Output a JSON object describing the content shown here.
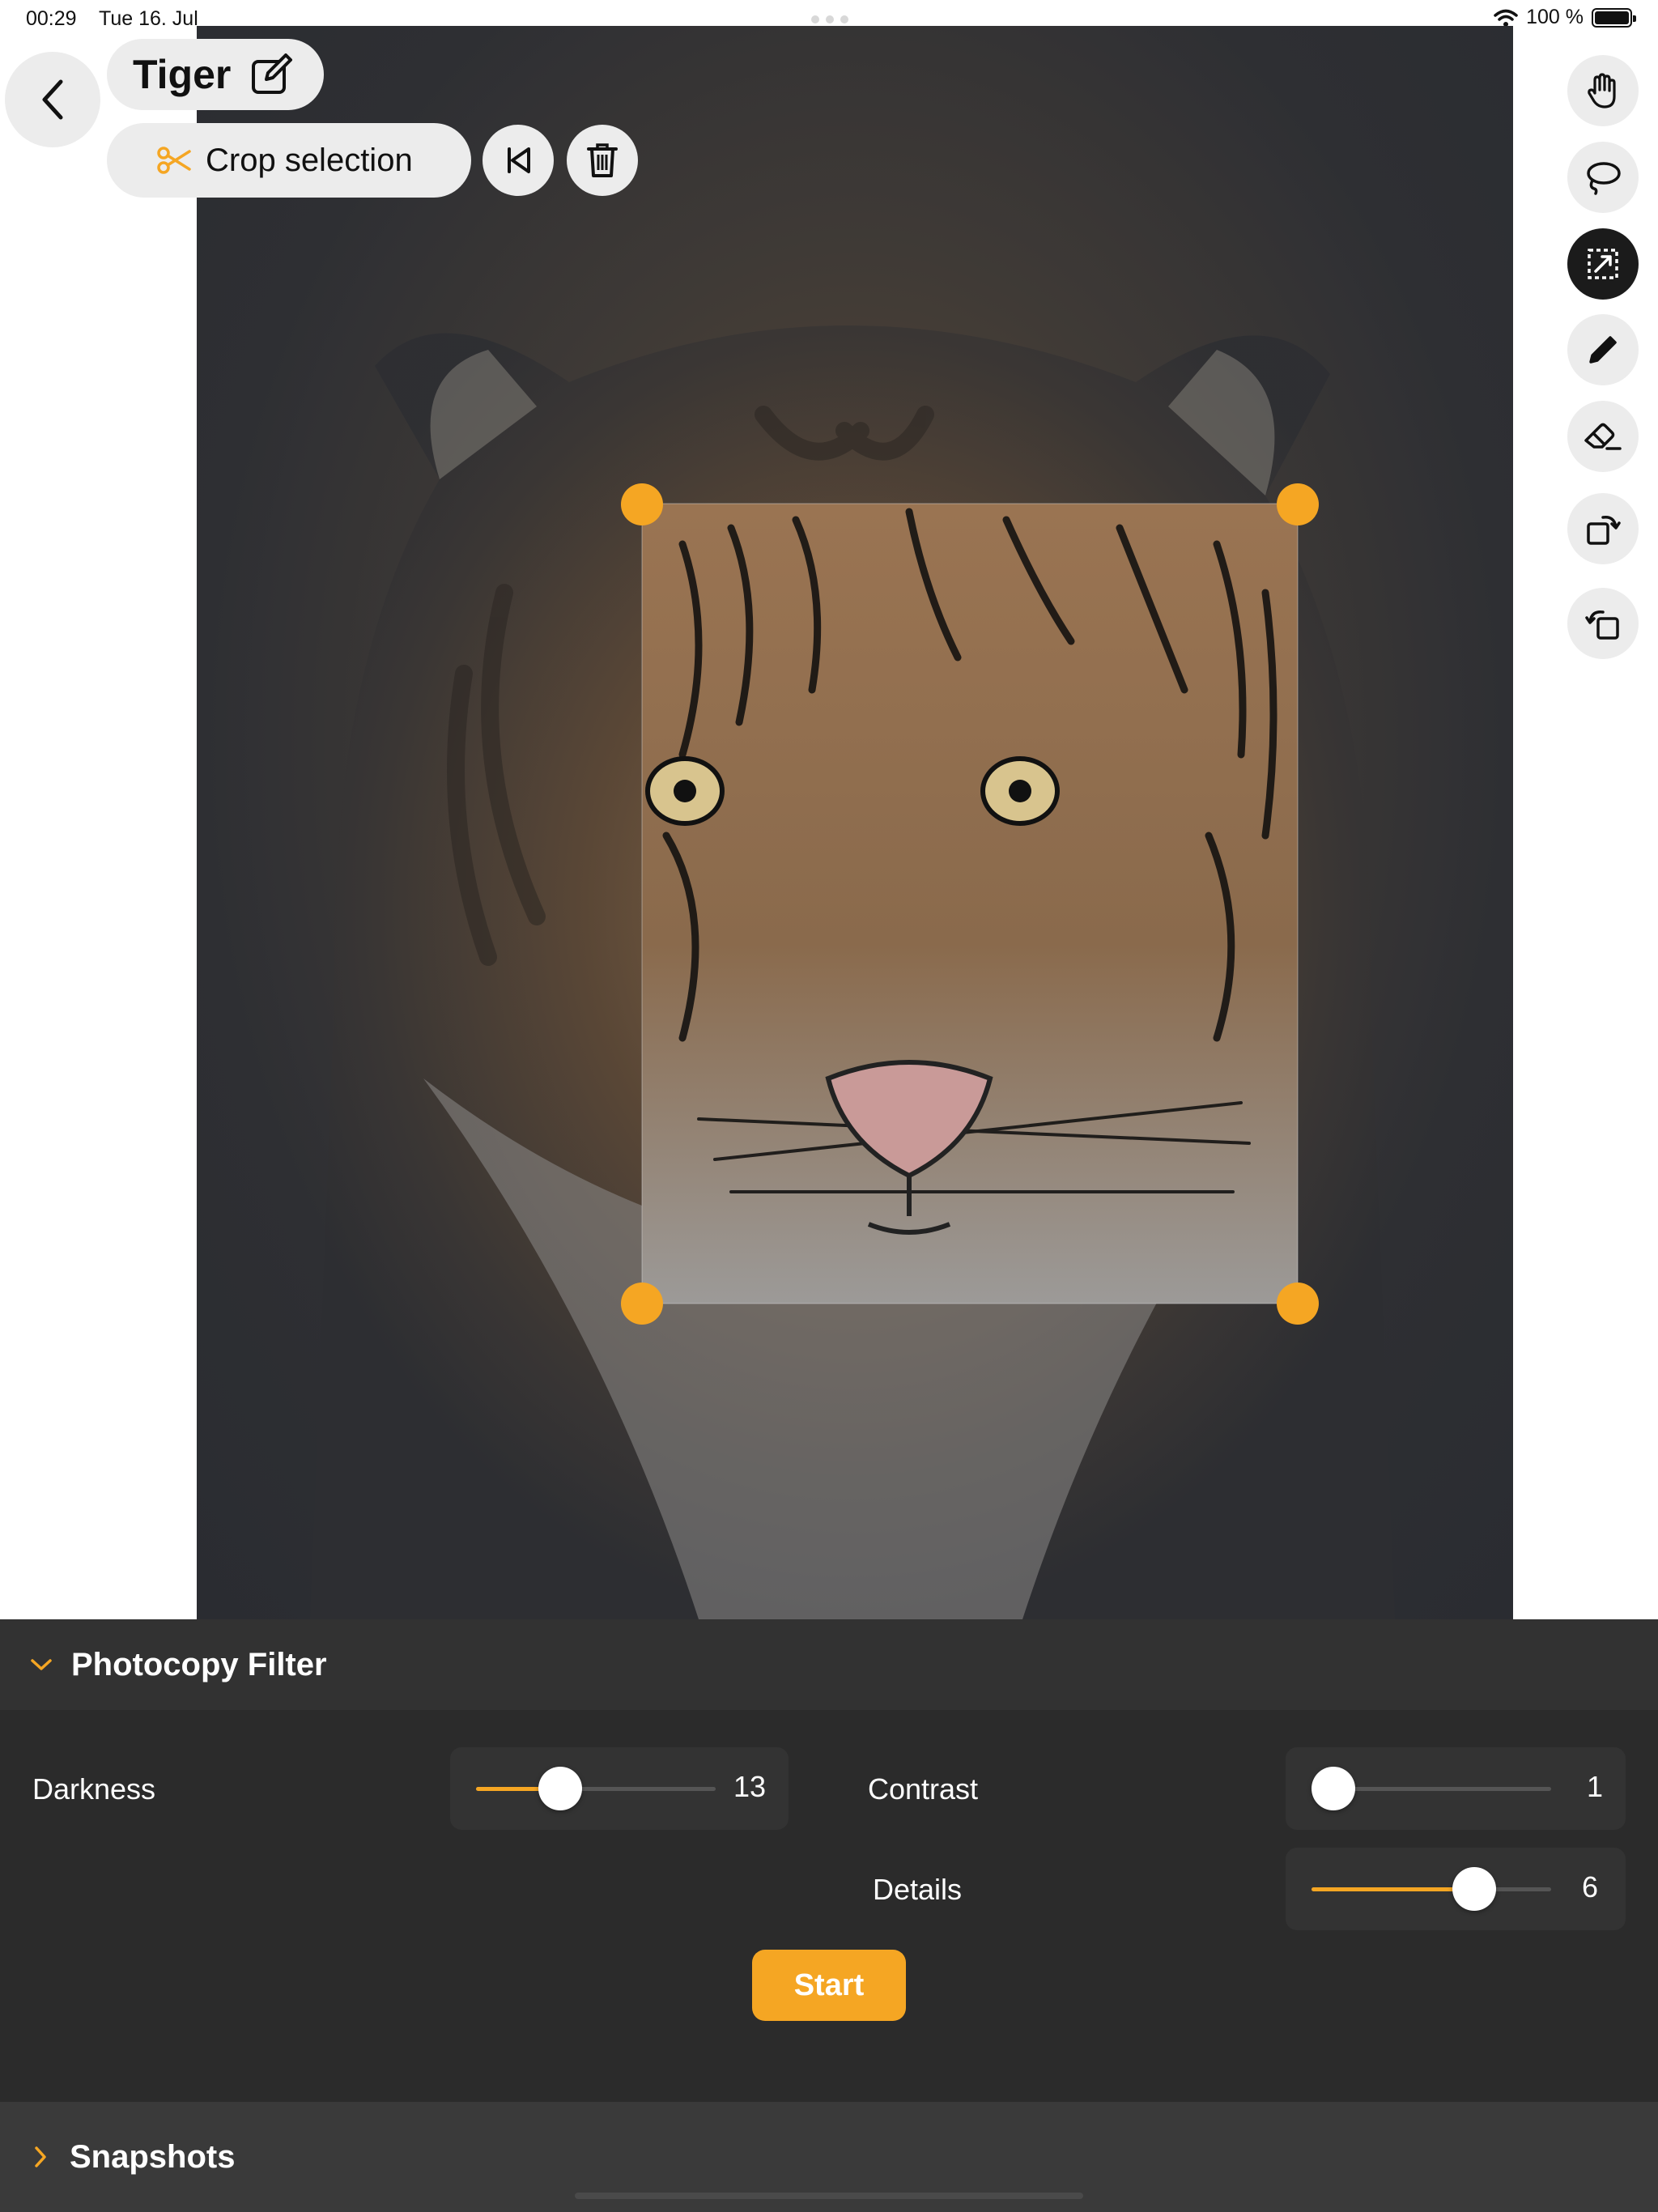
{
  "status_bar": {
    "time": "00:29",
    "date": "Tue 16. Jul",
    "battery": "100 %"
  },
  "document": {
    "title": "Tiger"
  },
  "toolbar": {
    "crop_label": "Crop selection"
  },
  "tools": [
    "hand-icon",
    "lasso-icon",
    "crop-frame-icon",
    "pencil-icon",
    "eraser-icon",
    "rotate-right-icon",
    "rotate-left-icon"
  ],
  "filter_panel": {
    "title": "Photocopy Filter",
    "darkness": {
      "label": "Darkness",
      "value": "13",
      "fraction": 0.35
    },
    "contrast": {
      "label": "Contrast",
      "value": "1",
      "fraction": 0.0
    },
    "details": {
      "label": "Details",
      "value": "6",
      "fraction": 0.68
    },
    "start_label": "Start"
  },
  "snapshots": {
    "title": "Snapshots"
  },
  "colors": {
    "accent": "#f5a623",
    "panel": "#2b2b2b"
  }
}
